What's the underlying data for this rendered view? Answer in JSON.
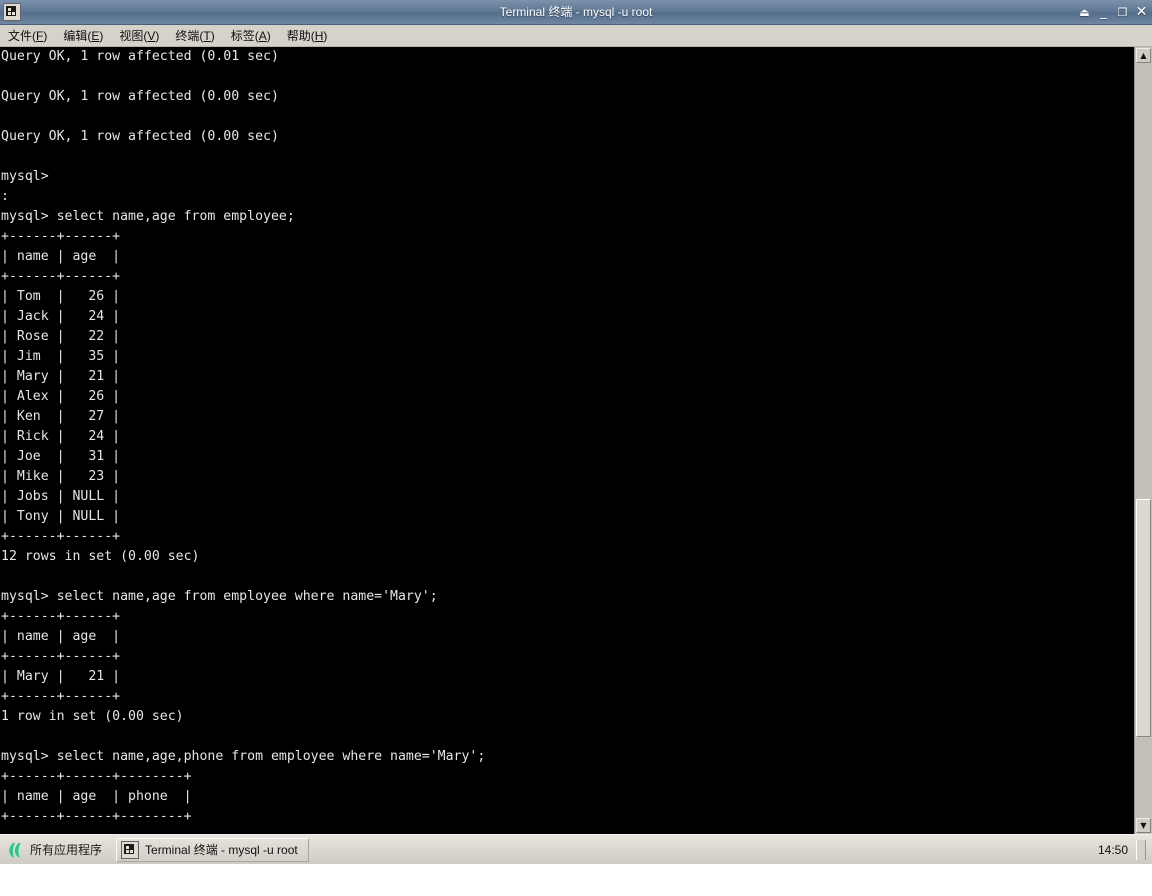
{
  "window": {
    "title": "Terminal 终端 - mysql -u root",
    "icon": "terminal-icon",
    "buttons": [
      {
        "name": "shade-button",
        "glyph": "⏏"
      },
      {
        "name": "minimize-button",
        "glyph": "_"
      },
      {
        "name": "maximize-button",
        "glyph": "❐"
      },
      {
        "name": "close-button",
        "glyph": "✕"
      }
    ]
  },
  "menubar": {
    "items": [
      {
        "label": "文件(F)",
        "text": "文件(",
        "mnemonic": "F",
        "tail": ")"
      },
      {
        "label": "编辑(E)",
        "text": "编辑(",
        "mnemonic": "E",
        "tail": ")"
      },
      {
        "label": "视图(V)",
        "text": "视图(",
        "mnemonic": "V",
        "tail": ")"
      },
      {
        "label": "终端(T)",
        "text": "终端(",
        "mnemonic": "T",
        "tail": ")"
      },
      {
        "label": "标签(A)",
        "text": "标签(",
        "mnemonic": "A",
        "tail": ")"
      },
      {
        "label": "帮助(H)",
        "text": "帮助(",
        "mnemonic": "H",
        "tail": ")"
      }
    ]
  },
  "terminal": {
    "foreground": "#e6e6e6",
    "background": "#000000",
    "lines": [
      "Query OK, 1 row affected (0.01 sec)",
      "",
      "Query OK, 1 row affected (0.00 sec)",
      "",
      "Query OK, 1 row affected (0.00 sec)",
      "",
      "mysql>",
      ":",
      "mysql> select name,age from employee;",
      "+------+------+",
      "| name | age  |",
      "+------+------+",
      "| Tom  |   26 |",
      "| Jack |   24 |",
      "| Rose |   22 |",
      "| Jim  |   35 |",
      "| Mary |   21 |",
      "| Alex |   26 |",
      "| Ken  |   27 |",
      "| Rick |   24 |",
      "| Joe  |   31 |",
      "| Mike |   23 |",
      "| Jobs | NULL |",
      "| Tony | NULL |",
      "+------+------+",
      "12 rows in set (0.00 sec)",
      "",
      "mysql> select name,age from employee where name='Mary';",
      "+------+------+",
      "| name | age  |",
      "+------+------+",
      "| Mary |   21 |",
      "+------+------+",
      "1 row in set (0.00 sec)",
      "",
      "mysql> select name,age,phone from employee where name='Mary';",
      "+------+------+--------+",
      "| name | age  | phone  |",
      "+------+------+--------+"
    ]
  },
  "scrollbar": {
    "up_arrow": "▲",
    "down_arrow": "▼"
  },
  "taskbar": {
    "apps_label": "所有应用程序",
    "task_label": "Terminal 终端 - mysql -u root",
    "clock": "14:50"
  }
}
